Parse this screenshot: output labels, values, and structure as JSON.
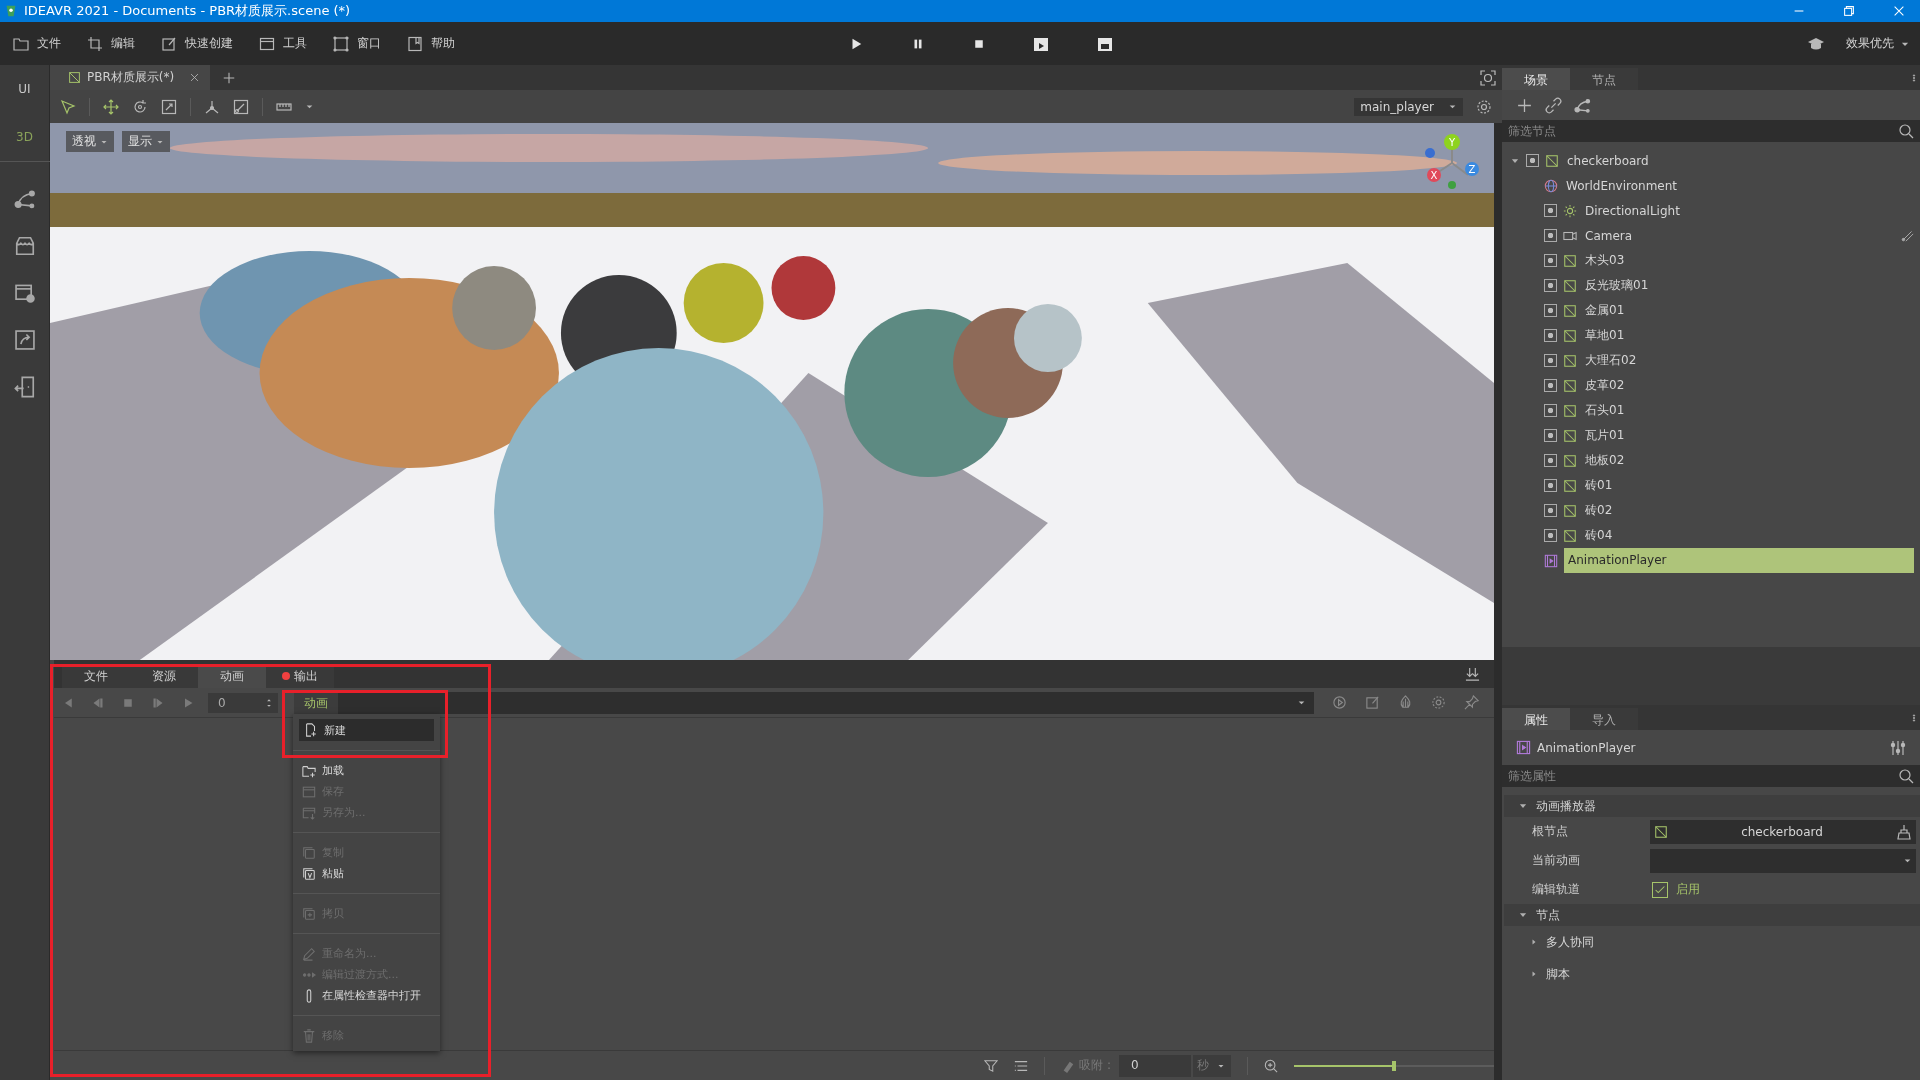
{
  "window": {
    "title": "IDEAVR 2021 - Documents - PBR材质展示.scene (*)"
  },
  "menu": [
    {
      "label": "文件"
    },
    {
      "label": "编辑"
    },
    {
      "label": "快速创建"
    },
    {
      "label": "工具"
    },
    {
      "label": "窗口"
    },
    {
      "label": "帮助"
    }
  ],
  "quality": {
    "label": "效果优先"
  },
  "sidebar": {
    "modes": [
      {
        "label": "UI",
        "selected": false
      },
      {
        "label": "3D",
        "selected": true
      }
    ]
  },
  "editor_tabs": [
    {
      "label": "PBR材质展示(*)",
      "selected": true
    }
  ],
  "viewport": {
    "camera_select": "main_player",
    "view_buttons": [
      {
        "label": "透视"
      },
      {
        "label": "显示"
      }
    ],
    "gizmo": {
      "y": "Y",
      "x": "X",
      "z": "Z"
    },
    "kind": "picture"
  },
  "scene_dock": {
    "tabs": [
      {
        "label": "场景",
        "selected": true
      },
      {
        "label": "节点",
        "selected": false
      }
    ],
    "filter": {
      "placeholder": "筛选节点"
    },
    "tree": [
      {
        "name": "checkerboard",
        "kind": "mesh",
        "visible": true,
        "expanded": true,
        "selected": false,
        "children": [
          {
            "name": "WorldEnvironment",
            "kind": "environment",
            "selected": false
          },
          {
            "name": "DirectionalLight",
            "kind": "light",
            "visible": true,
            "selected": false
          },
          {
            "name": "Camera",
            "kind": "camera",
            "visible": true,
            "selected": false,
            "path_marker": true
          },
          {
            "name": "木头03",
            "kind": "mesh",
            "visible": true,
            "selected": false
          },
          {
            "name": "反光玻璃01",
            "kind": "mesh",
            "visible": true,
            "selected": false
          },
          {
            "name": "金属01",
            "kind": "mesh",
            "visible": true,
            "selected": false
          },
          {
            "name": "草地01",
            "kind": "mesh",
            "visible": true,
            "selected": false
          },
          {
            "name": "大理石02",
            "kind": "mesh",
            "visible": true,
            "selected": false
          },
          {
            "name": "皮革02",
            "kind": "mesh",
            "visible": true,
            "selected": false
          },
          {
            "name": "石头01",
            "kind": "mesh",
            "visible": true,
            "selected": false
          },
          {
            "name": "瓦片01",
            "kind": "mesh",
            "visible": true,
            "selected": false
          },
          {
            "name": "地板02",
            "kind": "mesh",
            "visible": true,
            "selected": false
          },
          {
            "name": "砖01",
            "kind": "mesh",
            "visible": true,
            "selected": false
          },
          {
            "name": "砖02",
            "kind": "mesh",
            "visible": true,
            "selected": false
          },
          {
            "name": "砖04",
            "kind": "mesh",
            "visible": true,
            "selected": false
          },
          {
            "name": "AnimationPlayer",
            "kind": "animation",
            "selected": true
          }
        ]
      }
    ]
  },
  "bottom_panel": {
    "highlighted": true,
    "tabs": [
      {
        "label": "文件",
        "selected": false
      },
      {
        "label": "资源",
        "selected": false
      },
      {
        "label": "动画",
        "selected": true
      },
      {
        "label": "输出",
        "selected": false,
        "alert": true
      }
    ],
    "frame": "0",
    "animation_label": "动画",
    "menu": [
      {
        "kind": "item",
        "label": "新建",
        "disabled": false,
        "selected": true,
        "highlighted": true
      },
      {
        "kind": "separator"
      },
      {
        "kind": "item",
        "label": "加载",
        "disabled": false,
        "selected": false
      },
      {
        "kind": "item",
        "label": "保存",
        "disabled": true,
        "selected": false
      },
      {
        "kind": "item",
        "label": "另存为...",
        "disabled": true,
        "selected": false
      },
      {
        "kind": "separator"
      },
      {
        "kind": "item",
        "label": "复制",
        "disabled": true,
        "selected": false
      },
      {
        "kind": "item",
        "label": "粘贴",
        "disabled": false,
        "selected": false
      },
      {
        "kind": "separator"
      },
      {
        "kind": "item",
        "label": "拷贝",
        "disabled": true,
        "selected": false
      },
      {
        "kind": "separator"
      },
      {
        "kind": "item",
        "label": "重命名为...",
        "disabled": true,
        "selected": false
      },
      {
        "kind": "item",
        "label": "编辑过渡方式...",
        "disabled": true,
        "selected": false
      },
      {
        "kind": "item",
        "label": "在属性检查器中打开",
        "disabled": false,
        "selected": false
      },
      {
        "kind": "separator"
      },
      {
        "kind": "item",
        "label": "移除",
        "disabled": true,
        "selected": false
      }
    ],
    "snap_label": "吸附 :",
    "snap_value": "0",
    "unit": "秒",
    "zoom": {
      "level": 0.5
    }
  },
  "inspector": {
    "tabs": [
      {
        "label": "属性",
        "selected": true
      },
      {
        "label": "导入",
        "selected": false
      }
    ],
    "node": "AnimationPlayer",
    "filter": {
      "placeholder": "筛选属性"
    },
    "rows": [
      {
        "kind": "section",
        "label": "动画播放器",
        "expanded": true
      },
      {
        "kind": "node_ref",
        "label": "根节点",
        "value": "checkerboard"
      },
      {
        "kind": "dropdown",
        "label": "当前动画"
      },
      {
        "kind": "checkbox",
        "label": "编辑轨道",
        "value": "启用",
        "checked": true
      },
      {
        "kind": "section",
        "label": "节点",
        "expanded": true
      },
      {
        "kind": "subsection",
        "label": "多人协同",
        "expanded": false
      },
      {
        "kind": "subsection",
        "label": "脚本",
        "expanded": false
      }
    ]
  }
}
